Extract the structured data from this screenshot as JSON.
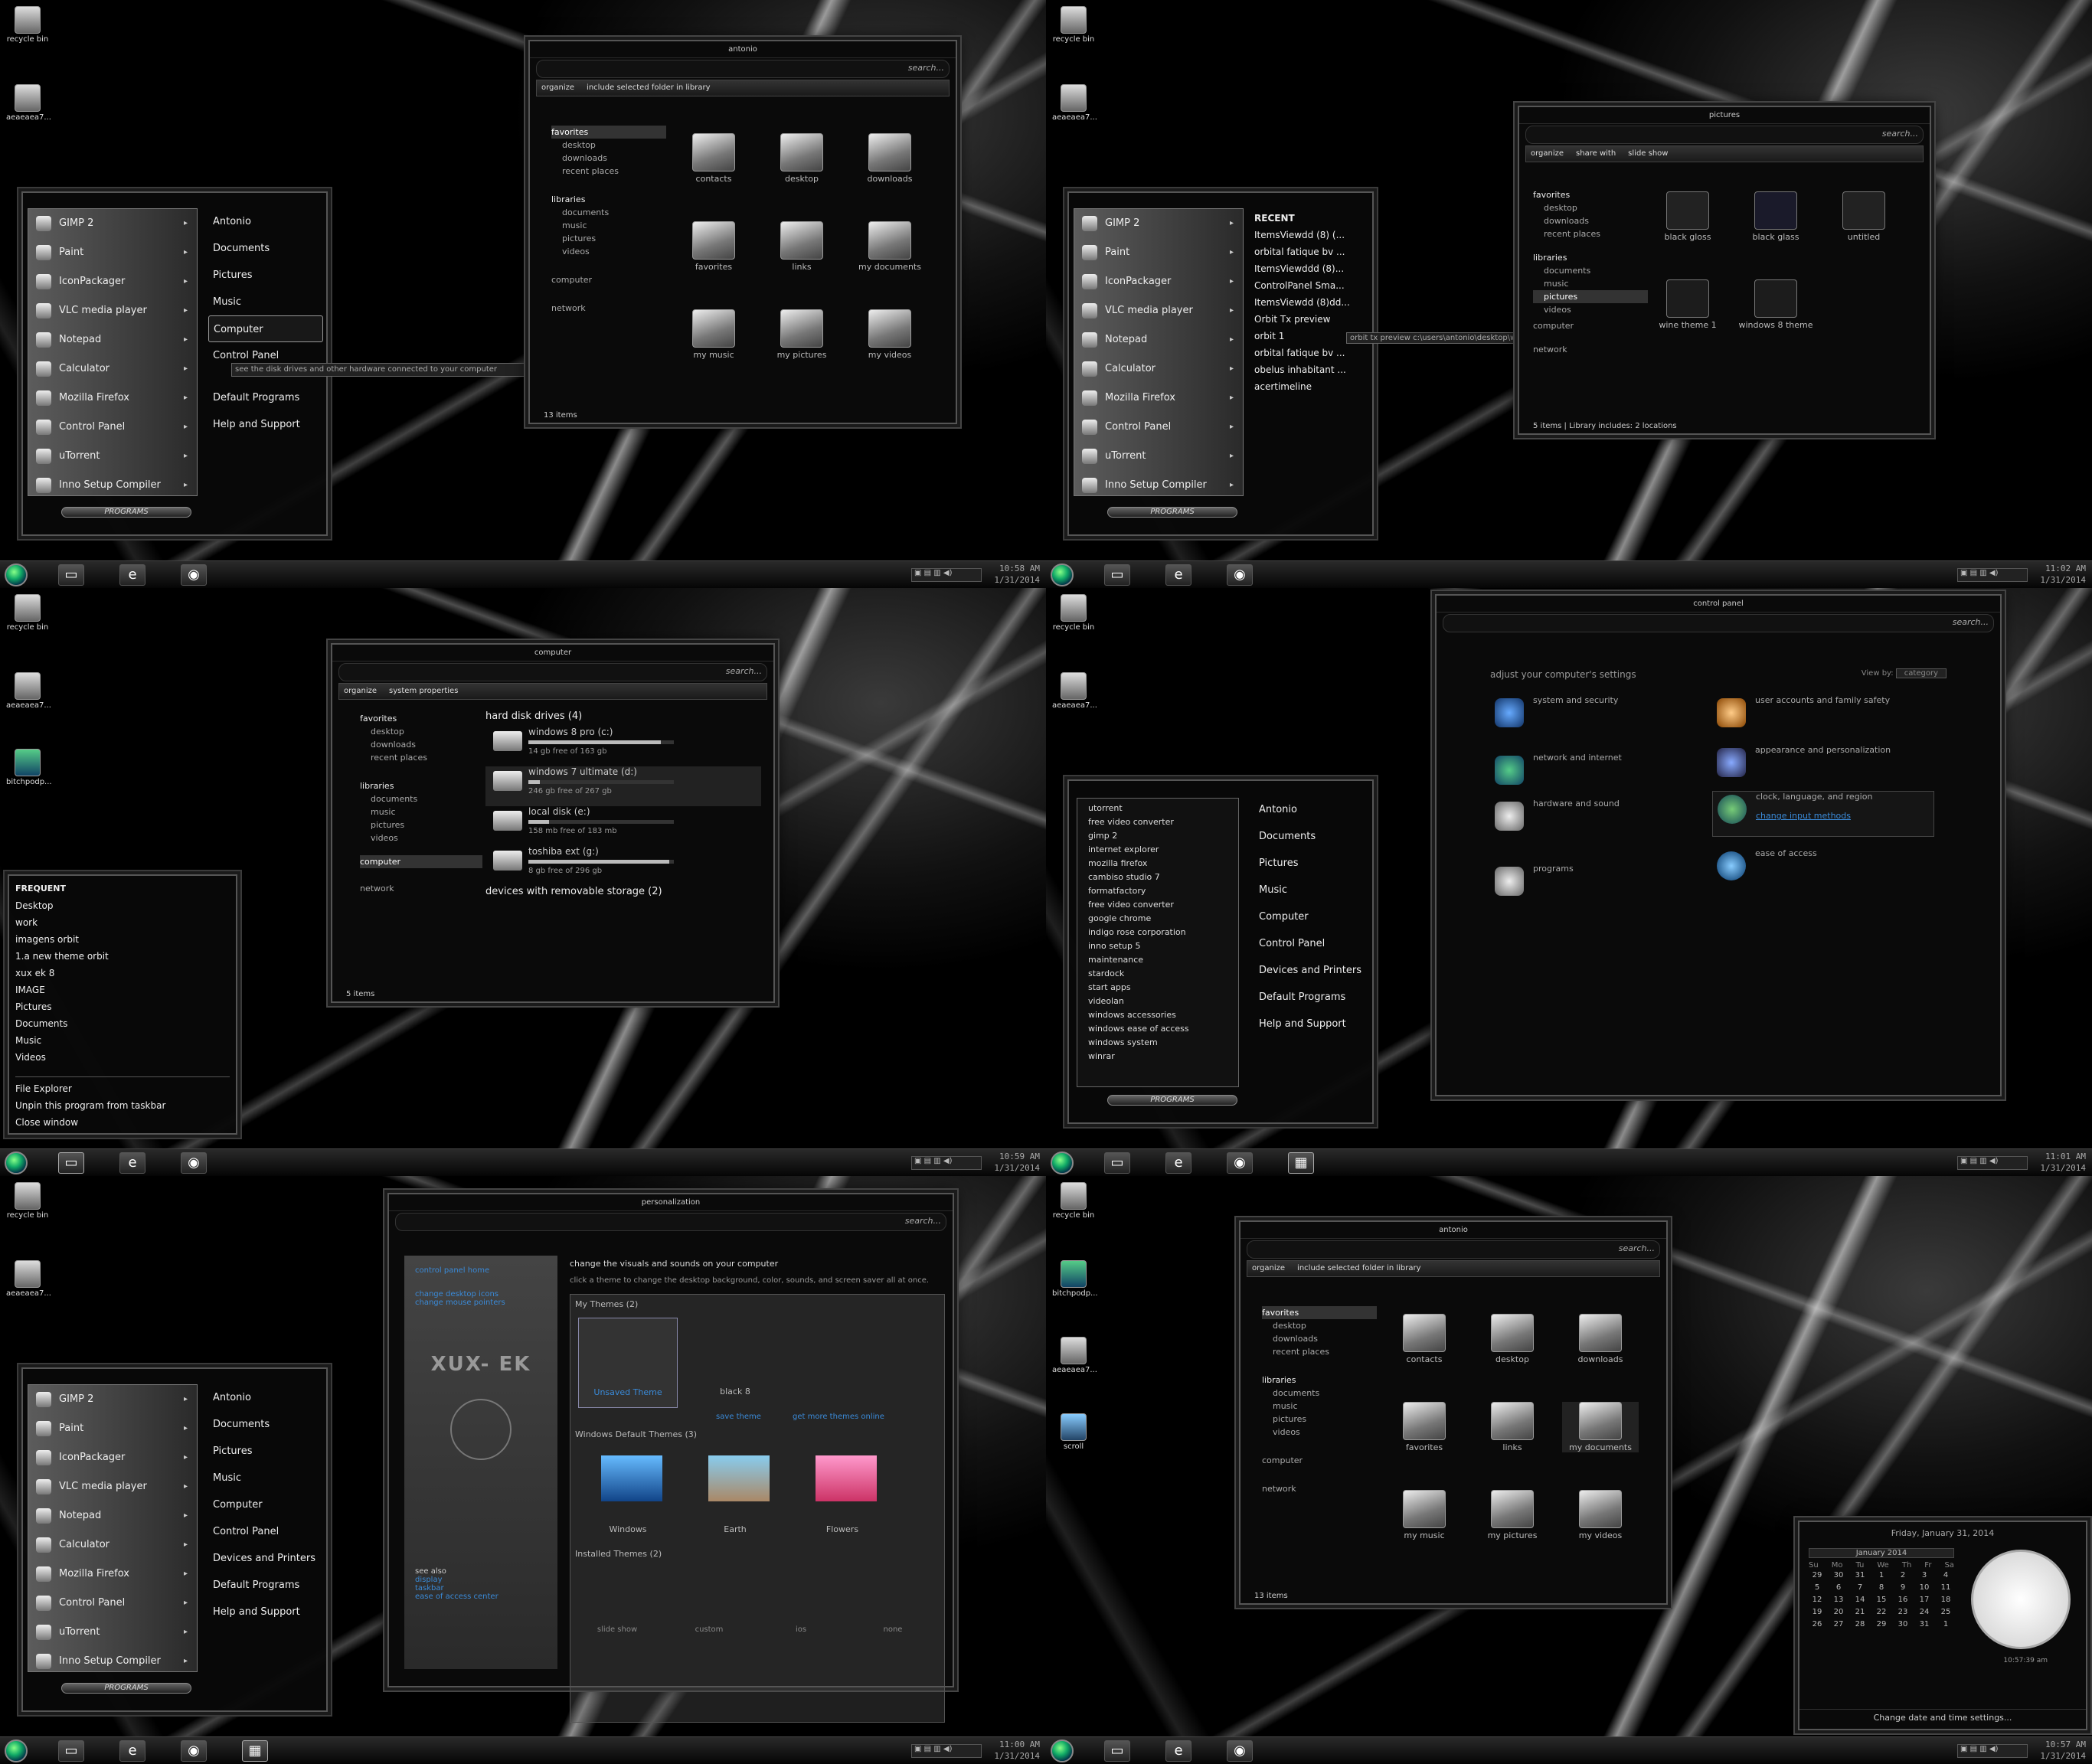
{
  "desktop": {
    "recycle": "recycle bin",
    "file": "aeaeaea7...",
    "doc": "bitchpodp...",
    "scroll": "scroll"
  },
  "taskbar": {
    "t1": "10:58 AM",
    "t2": "11:02 AM",
    "t3": "10:59 AM",
    "t4": "11:01 AM",
    "t5": "11:00 AM",
    "t6": "10:57 AM",
    "date": "1/31/2014"
  },
  "startmenu": {
    "items": [
      "GIMP 2",
      "Paint",
      "IconPackager",
      "VLC media player",
      "Notepad",
      "Calculator",
      "Mozilla Firefox",
      "Control Panel",
      "uTorrent",
      "Inno Setup Compiler"
    ],
    "right": [
      "Antonio",
      "Documents",
      "Pictures",
      "Music",
      "Computer",
      "Control Panel",
      "Devices and Printers",
      "Default Programs",
      "Help and Support"
    ],
    "programs": "PROGRAMS",
    "tooltip1": "see the disk drives and other hardware connected to your computer",
    "recent_title": "RECENT",
    "recent": [
      "ItemsViewdd (8) (...",
      "orbital fatique bv ...",
      "ItemsViewddd (8)...",
      "ControlPanel Sma...",
      "ItemsViewdd (8)dd...",
      "Orbit Tx preview",
      "orbit 1",
      "orbital fatique bv ...",
      "obelus inhabitant ...",
      "acertimeline"
    ],
    "tooltip2": "orbit tx preview c:\\users\\antonio\\desktop\\work",
    "allprogs": [
      "utorrent",
      "free video converter",
      "gimp 2",
      "internet explorer",
      "mozilla firefox",
      "cambiso studio 7",
      "formatfactory",
      "free video converter",
      "google chrome",
      "indigo rose corporation",
      "inno setup 5",
      "maintenance",
      "stardock",
      "start apps",
      "videolan",
      "windows accessories",
      "windows ease of access",
      "windows system",
      "winrar"
    ]
  },
  "explorer": {
    "title": "antonio",
    "search": "search...",
    "organize": "organize",
    "include": "include selected folder in library",
    "status": "13 items",
    "nav": [
      "favorites",
      "desktop",
      "downloads",
      "recent places",
      "libraries",
      "documents",
      "music",
      "pictures",
      "videos",
      "computer",
      "network"
    ],
    "tiles": [
      "contacts",
      "desktop",
      "downloads",
      "favorites",
      "links",
      "my documents",
      "my music",
      "my pictures",
      "my videos"
    ]
  },
  "pictures": {
    "title": "pictures",
    "share": "share with",
    "slide": "slide show",
    "status": "5 items",
    "lib": "Library includes: 2 locations",
    "tiles": [
      "black gloss",
      "black glass",
      "untitled",
      "wine theme 1",
      "windows 8 theme"
    ]
  },
  "computer": {
    "title": "computer",
    "props": "system properties",
    "hdd": "hard disk drives (4)",
    "removable": "devices with removable storage (2)",
    "status": "5 items",
    "drives": [
      {
        "n": "windows 8 pro (c:)",
        "s": "14 gb free of 163 gb"
      },
      {
        "n": "windows 7 ultimate (d:)",
        "s": "246 gb free of 267 gb"
      },
      {
        "n": "local disk (e:)",
        "s": "158 mb free of 183 mb"
      },
      {
        "n": "toshiba ext (g:)",
        "s": "8 gb free of 296 gb"
      }
    ]
  },
  "jumplist": {
    "title": "FREQUENT",
    "items": [
      "Desktop",
      "work",
      "imagens orbit",
      "1.a new theme orbit",
      "xux ek 8",
      "IMAGE",
      "Pictures",
      "Documents",
      "Music",
      "Videos"
    ],
    "tasks": [
      "File Explorer",
      "Unpin this program from taskbar",
      "Close window"
    ]
  },
  "control": {
    "title": "control panel",
    "heading": "adjust your computer's settings",
    "viewby": "View by:",
    "category": "category",
    "cats": [
      "system and security",
      "network and internet",
      "hardware and sound",
      "programs",
      "user accounts and family safety",
      "appearance and personalization",
      "clock, language, and region",
      "ease of access"
    ],
    "link": "change input methods"
  },
  "person": {
    "title": "personalization",
    "home": "control panel home",
    "l1": "change desktop icons",
    "l2": "change mouse pointers",
    "logo": "XUX- EK",
    "h": "change the visuals and sounds on your computer",
    "d": "click a theme to change the desktop background, color, sounds, and screen saver all at once.",
    "my": "My Themes (2)",
    "unsaved": "Unsaved Theme",
    "black8": "black 8",
    "save": "save theme",
    "more": "get more themes online",
    "def": "Windows Default Themes (3)",
    "themes": [
      "Windows",
      "Earth",
      "Flowers"
    ],
    "inst": "Installed Themes (2)",
    "bottom": [
      "slide show",
      "custom",
      "ios",
      "none"
    ],
    "see": "see also",
    "see1": "display",
    "see2": "taskbar",
    "see3": "ease of access center"
  },
  "calendar": {
    "date": "Friday, January 31, 2014",
    "month": "January 2014",
    "days": [
      "Su",
      "Mo",
      "Tu",
      "We",
      "Th",
      "Fr",
      "Sa"
    ],
    "rows": [
      [
        "29",
        "30",
        "31",
        "1",
        "2",
        "3",
        "4"
      ],
      [
        "5",
        "6",
        "7",
        "8",
        "9",
        "10",
        "11"
      ],
      [
        "12",
        "13",
        "14",
        "15",
        "16",
        "17",
        "18"
      ],
      [
        "19",
        "20",
        "21",
        "22",
        "23",
        "24",
        "25"
      ],
      [
        "26",
        "27",
        "28",
        "29",
        "30",
        "31",
        "1"
      ]
    ],
    "time": "10:57:39 am",
    "change": "Change date and time settings..."
  }
}
